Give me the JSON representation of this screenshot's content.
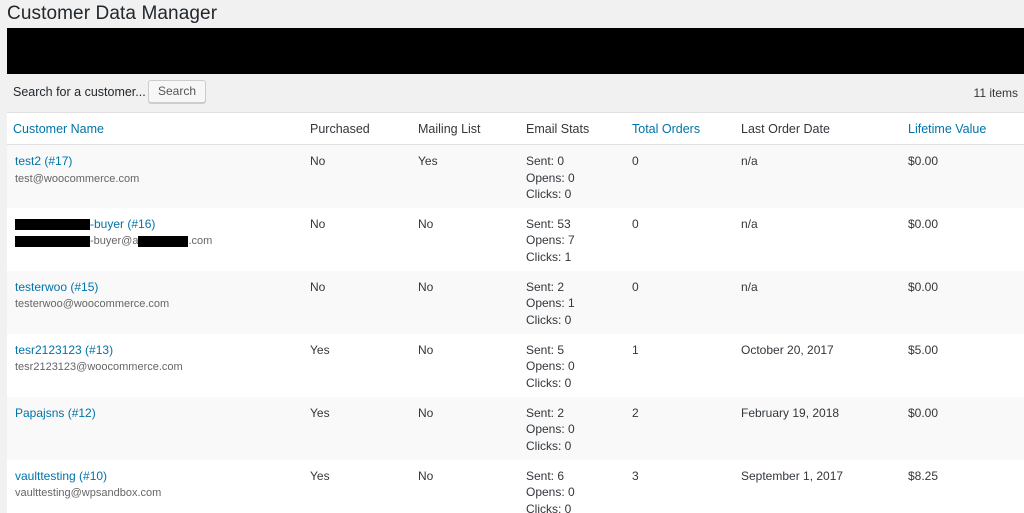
{
  "page": {
    "title": "Customer Data Manager"
  },
  "tablenav": {
    "search_label": "Search for a customer...",
    "search_button": "Search",
    "items_count": "11 items"
  },
  "table": {
    "headers": {
      "name": "Customer Name",
      "purchased": "Purchased",
      "mailing": "Mailing List",
      "email_stats": "Email Stats",
      "total_orders": "Total Orders",
      "last_order": "Last Order Date",
      "lifetime": "Lifetime Value"
    },
    "rows": [
      {
        "name": "test2 (#17)",
        "email": "test@woocommerce.com",
        "purchased": "No",
        "mailing": "Yes",
        "sent": "Sent: 0",
        "opens": "Opens: 0",
        "clicks": "Clicks: 0",
        "orders": "0",
        "last": "n/a",
        "value": "$0.00"
      },
      {
        "name": "-buyer (#16)",
        "email_a": "-buyer@a",
        "email_b": ".com",
        "purchased": "No",
        "mailing": "No",
        "sent": "Sent: 53",
        "opens": "Opens: 7",
        "clicks": "Clicks: 1",
        "orders": "0",
        "last": "n/a",
        "value": "$0.00"
      },
      {
        "name": "testerwoo (#15)",
        "email": "testerwoo@woocommerce.com",
        "purchased": "No",
        "mailing": "No",
        "sent": "Sent: 2",
        "opens": "Opens: 1",
        "clicks": "Clicks: 0",
        "orders": "0",
        "last": "n/a",
        "value": "$0.00"
      },
      {
        "name": "tesr2123123 (#13)",
        "email": "tesr2123123@woocommerce.com",
        "purchased": "Yes",
        "mailing": "No",
        "sent": "Sent: 5",
        "opens": "Opens: 0",
        "clicks": "Clicks: 0",
        "orders": "1",
        "last": "October 20, 2017",
        "value": "$5.00"
      },
      {
        "name": "Papajsns (#12)",
        "email": "",
        "purchased": "Yes",
        "mailing": "No",
        "sent": "Sent: 2",
        "opens": "Opens: 0",
        "clicks": "Clicks: 0",
        "orders": "2",
        "last": "February 19, 2018",
        "value": "$0.00"
      },
      {
        "name": "vaulttesting (#10)",
        "email": "vaulttesting@wpsandbox.com",
        "purchased": "Yes",
        "mailing": "No",
        "sent": "Sent: 6",
        "opens": "Opens: 0",
        "clicks": "Clicks: 0",
        "orders": "3",
        "last": "September 1, 2017",
        "value": "$8.25"
      }
    ]
  },
  "colors": {
    "link": "#0073aa",
    "background": "#f1f1f1",
    "redaction": "#000000"
  }
}
